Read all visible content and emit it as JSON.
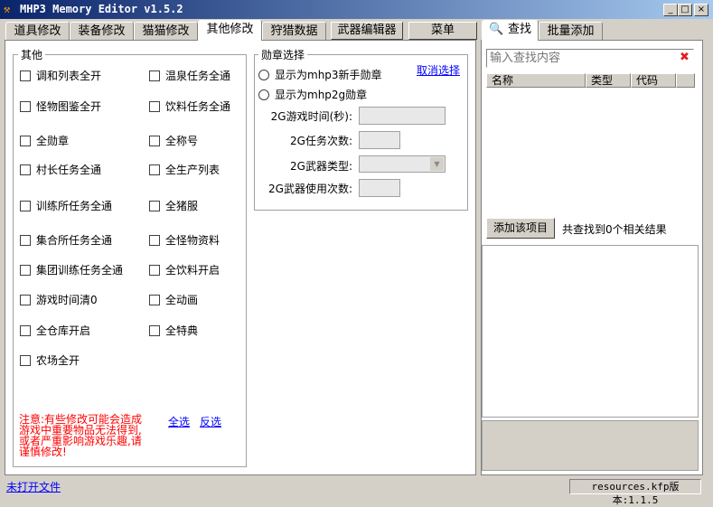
{
  "window": {
    "title": "MHP3 Memory Editor v1.5.2",
    "min": "_",
    "max": "□",
    "close": "×"
  },
  "tabs": [
    "道具修改",
    "装备修改",
    "猫猫修改",
    "其他修改",
    "狩猎数据"
  ],
  "buttons": {
    "weapon_editor": "武器编辑器",
    "menu": "菜单"
  },
  "other_group": {
    "title": "其他",
    "left": [
      "调和列表全开",
      "怪物图鉴全开",
      "全勋章",
      "村长任务全通",
      "训练所任务全通",
      "集合所任务全通",
      "集团训练任务全通",
      "游戏时间清0",
      "全仓库开启",
      "农场全开"
    ],
    "right": [
      "温泉任务全通",
      "饮料任务全通",
      "全称号",
      "全生产列表",
      "全猪服",
      "全怪物资料",
      "全饮料开启",
      "全动画",
      "全特典"
    ],
    "warning": "注意:有些修改可能会造成游戏中重要物品无法得到,或者严重影响游戏乐趣,请谨慎修改!",
    "select_all": "全选",
    "invert": "反选"
  },
  "medal_group": {
    "title": "勋章选择",
    "cancel": "取消选择",
    "radio1": "显示为mhp3新手勋章",
    "radio2": "显示为mhp2g勋章",
    "fields": [
      "2G游戏时间(秒):",
      "2G任务次数:",
      "2G武器类型:",
      "2G武器使用次数:"
    ]
  },
  "search": {
    "tabs": [
      "查找",
      "批量添加"
    ],
    "placeholder": "输入查找内容",
    "columns": [
      "名称",
      "类型",
      "代码"
    ],
    "add_button": "添加该项目",
    "result": "共查找到0个相关结果"
  },
  "status": {
    "file": "未打开文件",
    "version": "resources.kfp版本:1.1.5"
  }
}
